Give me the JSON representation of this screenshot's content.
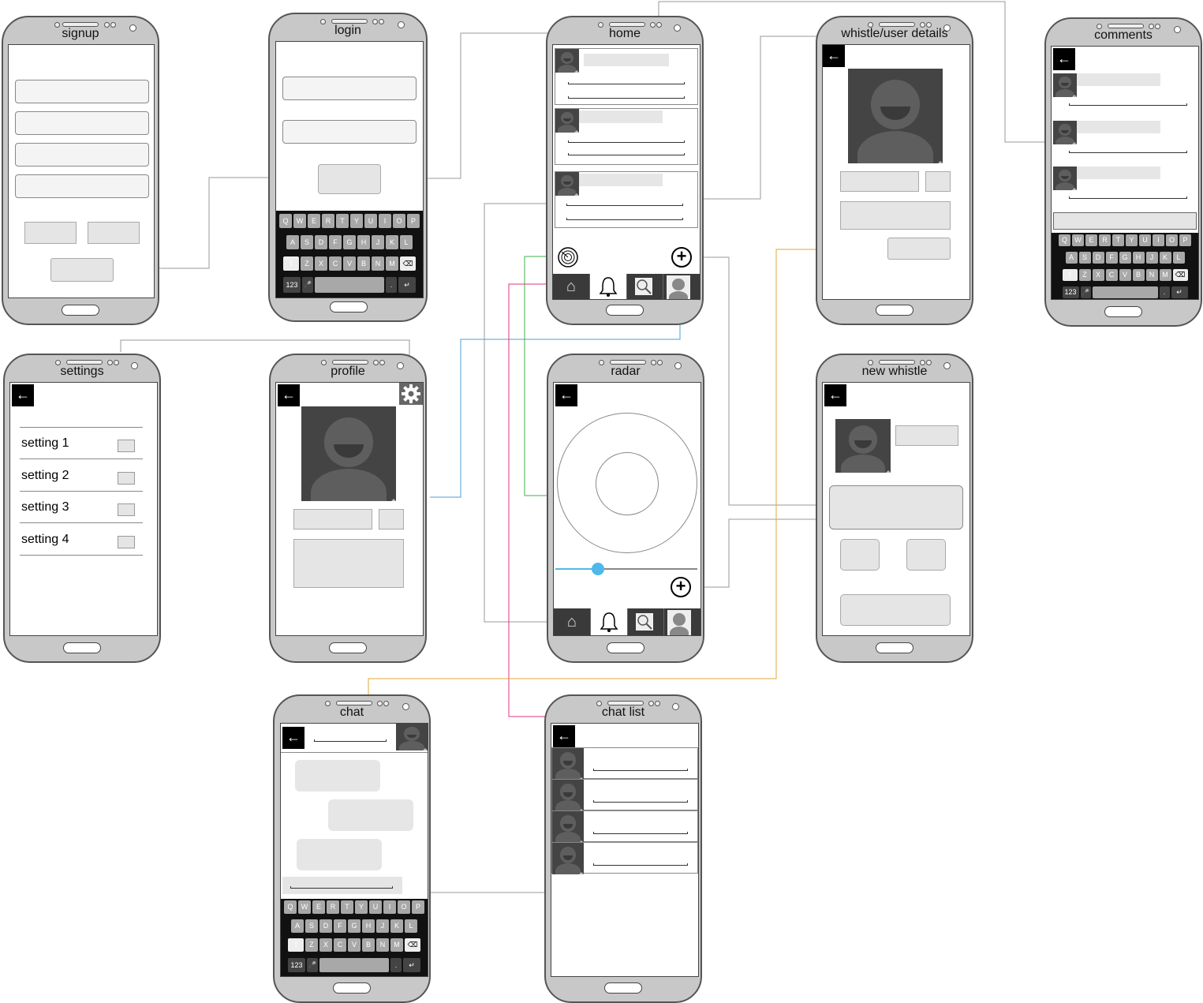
{
  "screens": {
    "signup": "signup",
    "login": "login",
    "home": "home",
    "whistle_user_details": "whistle/user details",
    "comments": "comments",
    "settings": "settings",
    "profile": "profile",
    "radar": "radar",
    "new_whistle": "new whistle",
    "chat": "chat",
    "chat_list": "chat list"
  },
  "settings_items": [
    "setting 1",
    "setting 2",
    "setting 3",
    "setting 4"
  ],
  "keyboard": {
    "row1": [
      "Q",
      "W",
      "E",
      "R",
      "T",
      "Y",
      "U",
      "I",
      "O",
      "P"
    ],
    "row2": [
      "A",
      "S",
      "D",
      "F",
      "G",
      "H",
      "J",
      "K",
      "L"
    ],
    "row3": [
      "Z",
      "X",
      "C",
      "V",
      "B",
      "N",
      "M"
    ],
    "numbers_key": "123",
    "period_key": "."
  },
  "icons": {
    "back": "arrow-left-icon",
    "add": "plus-circle-icon",
    "radar": "radar-icon",
    "home": "home-icon",
    "notifications": "bell-icon",
    "search": "search-icon",
    "profile": "user-icon",
    "settings": "gear-icon"
  },
  "link_colors": {
    "gray": "#9a9a9a",
    "blue": "#4a9fd6",
    "green": "#3fb24a",
    "pink": "#e0338a",
    "yellow": "#e0a93a"
  },
  "radar_slider": {
    "accent": "#4fb8ea",
    "value": 0.3
  }
}
